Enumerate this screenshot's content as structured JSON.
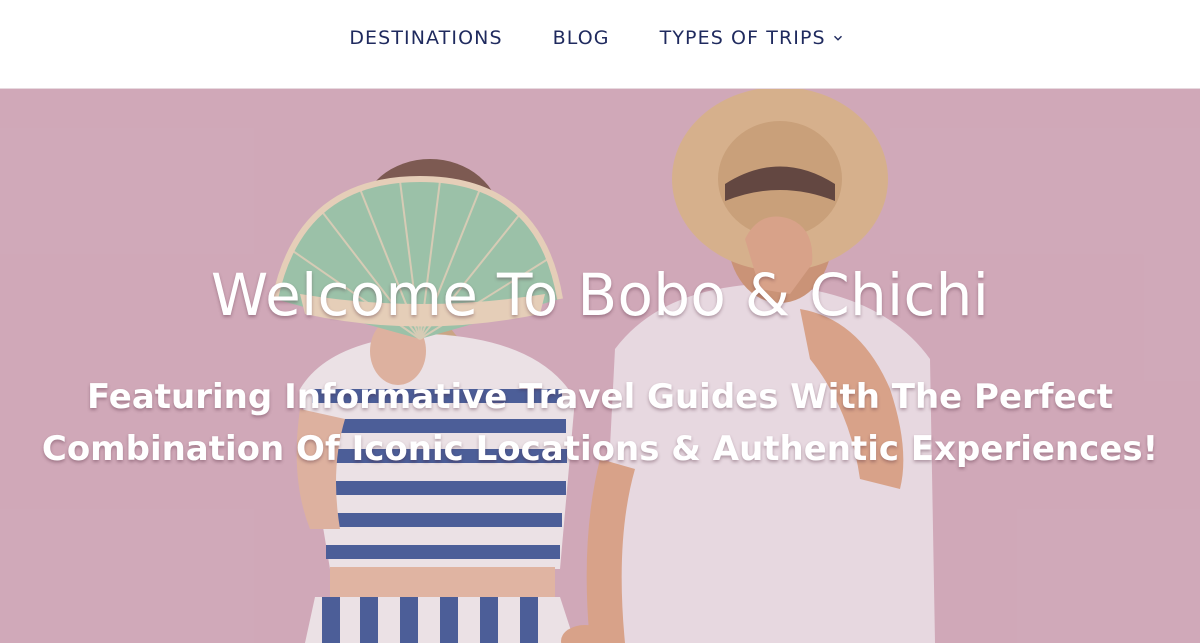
{
  "nav": {
    "items": [
      {
        "label": "DESTINATIONS"
      },
      {
        "label": "BLOG"
      },
      {
        "label": "TYPES OF TRIPS"
      }
    ],
    "dropdown_icon": "chevron-down-icon"
  },
  "hero": {
    "title": "Welcome To Bobo & Chichi",
    "subtitle_line1": "Featuring Informative Travel Guides With The Perfect",
    "subtitle_line2": "Combination Of Iconic Locations & Authentic Experiences!"
  },
  "colors": {
    "nav_text": "#1f2a5e",
    "hero_background": "#d0a9b9",
    "hero_text": "#ffffff"
  }
}
